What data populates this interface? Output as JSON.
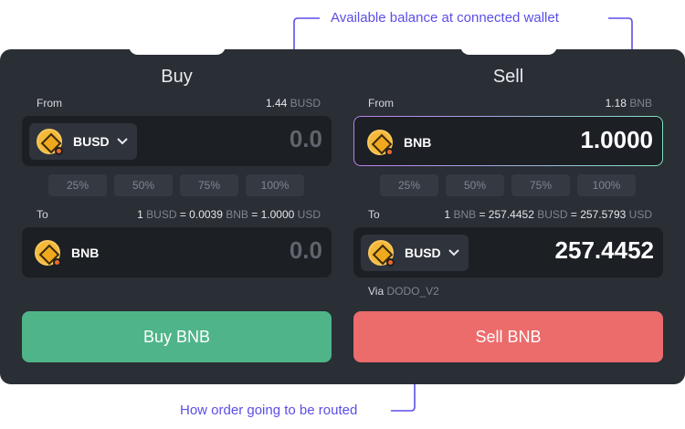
{
  "annotations": {
    "balance_note": "Available balance at connected wallet",
    "route_note": "How order going to be routed"
  },
  "buy": {
    "title": "Buy",
    "from_label": "From",
    "from_balance_amount": "1.44",
    "from_balance_unit": "BUSD",
    "from_token": "BUSD",
    "from_amount": "0.0",
    "percent_options": [
      "25%",
      "50%",
      "75%",
      "100%"
    ],
    "to_label": "To",
    "rate": {
      "one": "1",
      "base_unit": "BUSD",
      "eq1": "= 0.0039",
      "quote_unit": "BNB",
      "eq2": "= 1.0000",
      "usd_unit": "USD"
    },
    "to_token": "BNB",
    "to_amount": "0.0",
    "action_label": "Buy BNB"
  },
  "sell": {
    "title": "Sell",
    "from_label": "From",
    "from_balance_amount": "1.18",
    "from_balance_unit": "BNB",
    "from_token": "BNB",
    "from_amount": "1.0000",
    "percent_options": [
      "25%",
      "50%",
      "75%",
      "100%"
    ],
    "to_label": "To",
    "rate": {
      "one": "1",
      "base_unit": "BNB",
      "eq1": "= 257.4452",
      "quote_unit": "BUSD",
      "eq2": "= 257.5793",
      "usd_unit": "USD"
    },
    "to_token": "BUSD",
    "to_amount": "257.4452",
    "via_label": "Via",
    "via_route": "DODO_V2",
    "action_label": "Sell BNB"
  },
  "colors": {
    "panel": "#2a2e35",
    "input_bg": "#1c1f24",
    "buy_button": "#4fb588",
    "sell_button": "#ec6b6b",
    "annotation": "#5b4ee8"
  },
  "icons": {
    "token": "coin-icon",
    "dropdown": "chevron-down-icon"
  }
}
